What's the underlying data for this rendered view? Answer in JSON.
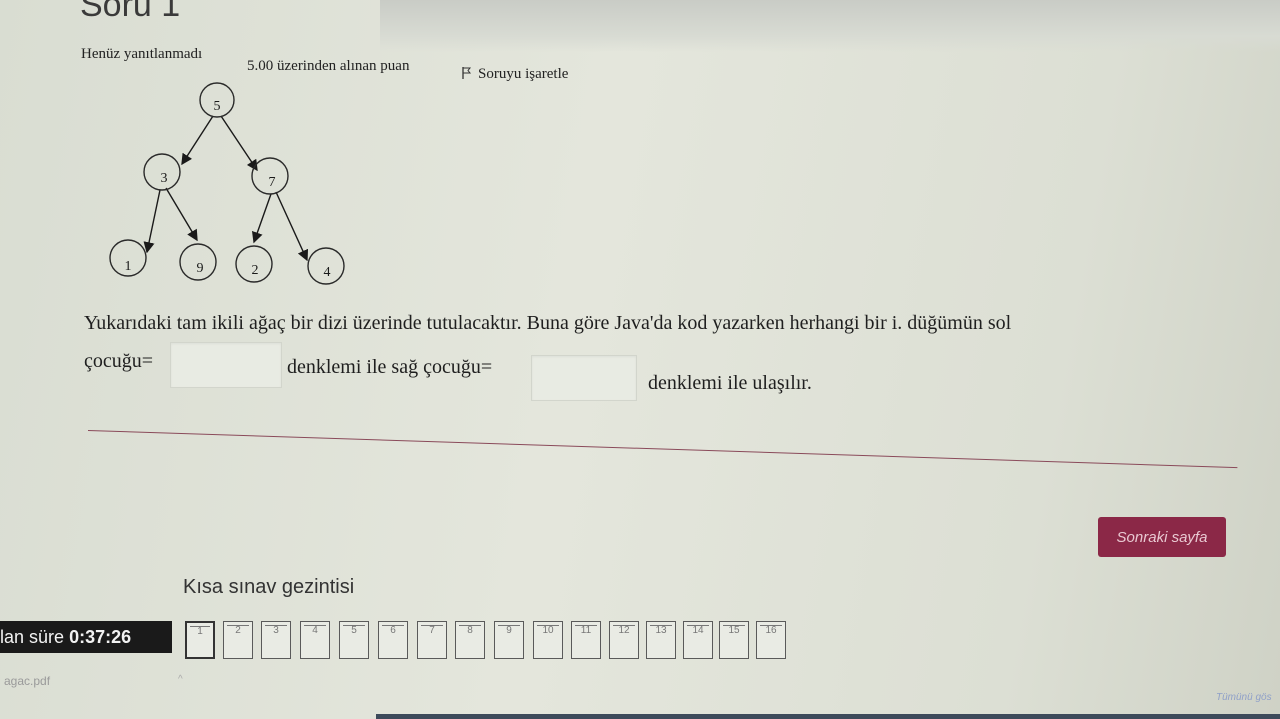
{
  "question": {
    "title": "Soru 1",
    "status": "Henüz yanıtlanmadı",
    "points": "5.00 üzerinden alınan puan",
    "flag_label": "Soruyu işaretle",
    "text_line1": "Yukarıdaki tam ikili ağaç bir dizi üzerinde tutulacaktır. Buna göre Java'da kod yazarken herhangi bir i. düğümün sol",
    "text_left_prefix": "çocuğu=",
    "text_middle": "denklemi ile sağ çocuğu=",
    "text_end": "denklemi ile ulaşılır.",
    "left_answer": "",
    "right_answer": ""
  },
  "tree": {
    "nodes": [
      "5",
      "3",
      "7",
      "1",
      "9",
      "2",
      "4"
    ]
  },
  "navigation": {
    "next_label": "Sonraki sayfa",
    "title": "Kısa sınav gezintisi",
    "timer_label": "lan süre",
    "timer_value": "0:37:26",
    "pages": [
      "1",
      "2",
      "3",
      "4",
      "5",
      "6",
      "7",
      "8",
      "9",
      "10",
      "11",
      "12",
      "13",
      "14",
      "15",
      "16"
    ]
  },
  "footer": {
    "file_name": "agac.pdf",
    "corner_link": "Tümünü gös"
  },
  "colors": {
    "accent": "#8b2847",
    "divider": "#8a4a5a",
    "timer_bg": "#1a1a1a"
  }
}
